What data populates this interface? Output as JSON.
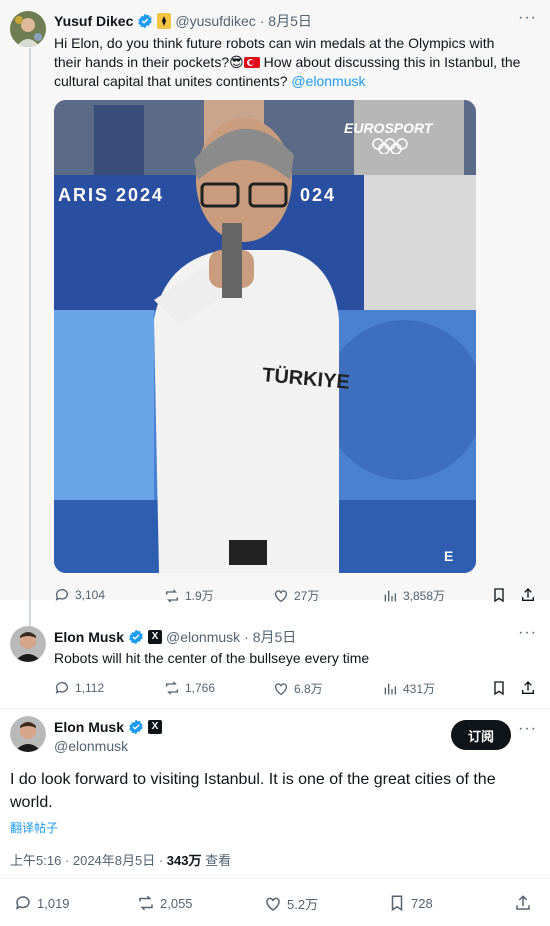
{
  "tweet1": {
    "name": "Yusuf Dikec",
    "handle": "@yusufdikec",
    "date": "· 8月5日",
    "text_main": "Hi Elon, do you think future robots can win medals at the Olympics with their hands in their pockets?",
    "emoji": "😎",
    "text_rest": " How about discussing this in Istanbul, the cultural capital that unites continents? ",
    "mention": "@elonmusk",
    "image": {
      "banner_left": "ARIS 2024",
      "banner_right": "024",
      "broadcaster": "EUROSPORT",
      "shirt": "TÜRKIYE"
    },
    "stats": {
      "replies": "3,104",
      "reposts": "1.9万",
      "likes": "27万",
      "views": "3,858万"
    }
  },
  "tweet2": {
    "name": "Elon Musk",
    "handle": "@elonmusk",
    "date": "· 8月5日",
    "text": "Robots will hit the center of the bullseye every time",
    "stats": {
      "replies": "1,112",
      "reposts": "1,766",
      "likes": "6.8万",
      "views": "431万"
    }
  },
  "tweet3": {
    "name": "Elon Musk",
    "handle": "@elonmusk",
    "subscribe_label": "订阅",
    "text": "I do look forward to visiting Istanbul. It is one of the great cities of the world.",
    "translate_label": "翻译帖子",
    "time": "上午5:16 · 2024年8月5日 · ",
    "views_count": "343万",
    "views_label": " 查看",
    "stats": {
      "replies": "1,019",
      "reposts": "2,055",
      "likes": "5.2万",
      "bookmarks": "728"
    }
  },
  "colors": {
    "accent": "#1d9bf0",
    "text": "#0f1419",
    "muted": "#536471",
    "verified": "#1d9bf0"
  }
}
